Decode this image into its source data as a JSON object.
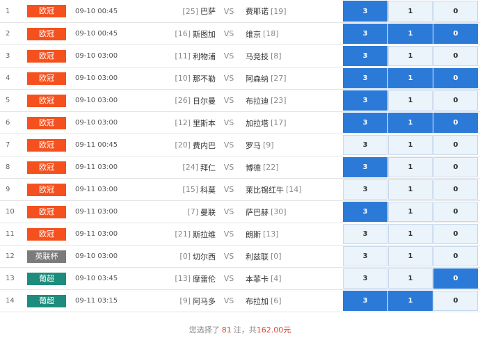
{
  "colors": {
    "league_ouguan": "#f4511e",
    "league_yinglianbei": "#7b7b7b",
    "league_puchao": "#1e8c7d",
    "selected": "#2b7ad7",
    "unselected": "#ebf3fb"
  },
  "matches": [
    {
      "idx": "1",
      "league": "欧冠",
      "time": "09-10 00:45",
      "home_rank": "[25]",
      "home": "巴萨",
      "vs": "VS",
      "away": "费耶诺",
      "away_rank": "[19]",
      "odds": [
        "3",
        "1",
        "0"
      ],
      "selected": [
        true,
        false,
        false
      ]
    },
    {
      "idx": "2",
      "league": "欧冠",
      "time": "09-10 00:45",
      "home_rank": "[16]",
      "home": "斯图加",
      "vs": "VS",
      "away": "维京",
      "away_rank": "[18]",
      "odds": [
        "3",
        "1",
        "0"
      ],
      "selected": [
        true,
        true,
        true
      ]
    },
    {
      "idx": "3",
      "league": "欧冠",
      "time": "09-10 03:00",
      "home_rank": "[11]",
      "home": "利物浦",
      "vs": "VS",
      "away": "马竞技",
      "away_rank": "[8]",
      "odds": [
        "3",
        "1",
        "0"
      ],
      "selected": [
        true,
        false,
        false
      ]
    },
    {
      "idx": "4",
      "league": "欧冠",
      "time": "09-10 03:00",
      "home_rank": "[10]",
      "home": "那不勒",
      "vs": "VS",
      "away": "阿森纳",
      "away_rank": "[27]",
      "odds": [
        "3",
        "1",
        "0"
      ],
      "selected": [
        true,
        true,
        true
      ]
    },
    {
      "idx": "5",
      "league": "欧冠",
      "time": "09-10 03:00",
      "home_rank": "[26]",
      "home": "日尔曼",
      "vs": "VS",
      "away": "布拉迪",
      "away_rank": "[23]",
      "odds": [
        "3",
        "1",
        "0"
      ],
      "selected": [
        true,
        false,
        false
      ]
    },
    {
      "idx": "6",
      "league": "欧冠",
      "time": "09-10 03:00",
      "home_rank": "[12]",
      "home": "里斯本",
      "vs": "VS",
      "away": "加拉塔",
      "away_rank": "[17]",
      "odds": [
        "3",
        "1",
        "0"
      ],
      "selected": [
        true,
        true,
        true
      ]
    },
    {
      "idx": "7",
      "league": "欧冠",
      "time": "09-11 00:45",
      "home_rank": "[20]",
      "home": "费内巴",
      "vs": "VS",
      "away": "罗马",
      "away_rank": "[9]",
      "odds": [
        "3",
        "1",
        "0"
      ],
      "selected": [
        false,
        false,
        false
      ]
    },
    {
      "idx": "8",
      "league": "欧冠",
      "time": "09-11 03:00",
      "home_rank": "[24]",
      "home": "拜仁",
      "vs": "VS",
      "away": "博德",
      "away_rank": "[22]",
      "odds": [
        "3",
        "1",
        "0"
      ],
      "selected": [
        true,
        false,
        false
      ]
    },
    {
      "idx": "9",
      "league": "欧冠",
      "time": "09-11 03:00",
      "home_rank": "[15]",
      "home": "科莫",
      "vs": "VS",
      "away": "莱比锡红牛",
      "away_rank": "[14]",
      "odds": [
        "3",
        "1",
        "0"
      ],
      "selected": [
        false,
        false,
        false
      ]
    },
    {
      "idx": "10",
      "league": "欧冠",
      "time": "09-11 03:00",
      "home_rank": "[7]",
      "home": "曼联",
      "vs": "VS",
      "away": "萨巴赫",
      "away_rank": "[30]",
      "odds": [
        "3",
        "1",
        "0"
      ],
      "selected": [
        true,
        false,
        false
      ]
    },
    {
      "idx": "11",
      "league": "欧冠",
      "time": "09-11 03:00",
      "home_rank": "[21]",
      "home": "斯拉维",
      "vs": "VS",
      "away": "朗斯",
      "away_rank": "[13]",
      "odds": [
        "3",
        "1",
        "0"
      ],
      "selected": [
        false,
        false,
        false
      ]
    },
    {
      "idx": "12",
      "league": "英联杯",
      "time": "09-10 03:00",
      "home_rank": "[0]",
      "home": "切尔西",
      "vs": "VS",
      "away": "利兹联",
      "away_rank": "[0]",
      "odds": [
        "3",
        "1",
        "0"
      ],
      "selected": [
        false,
        false,
        false
      ]
    },
    {
      "idx": "13",
      "league": "葡超",
      "time": "09-10 03:45",
      "home_rank": "[13]",
      "home": "摩雷伦",
      "vs": "VS",
      "away": "本菲卡",
      "away_rank": "[4]",
      "odds": [
        "3",
        "1",
        "0"
      ],
      "selected": [
        false,
        false,
        true
      ]
    },
    {
      "idx": "14",
      "league": "葡超",
      "time": "09-11 03:15",
      "home_rank": "[9]",
      "home": "阿马多",
      "vs": "VS",
      "away": "布拉加",
      "away_rank": "[6]",
      "odds": [
        "3",
        "1",
        "0"
      ],
      "selected": [
        true,
        true,
        false
      ]
    }
  ],
  "summary": {
    "prefix": "您选择了",
    "count": "81",
    "mid": "注，共",
    "amount": "162.00",
    "suffix": "元"
  }
}
